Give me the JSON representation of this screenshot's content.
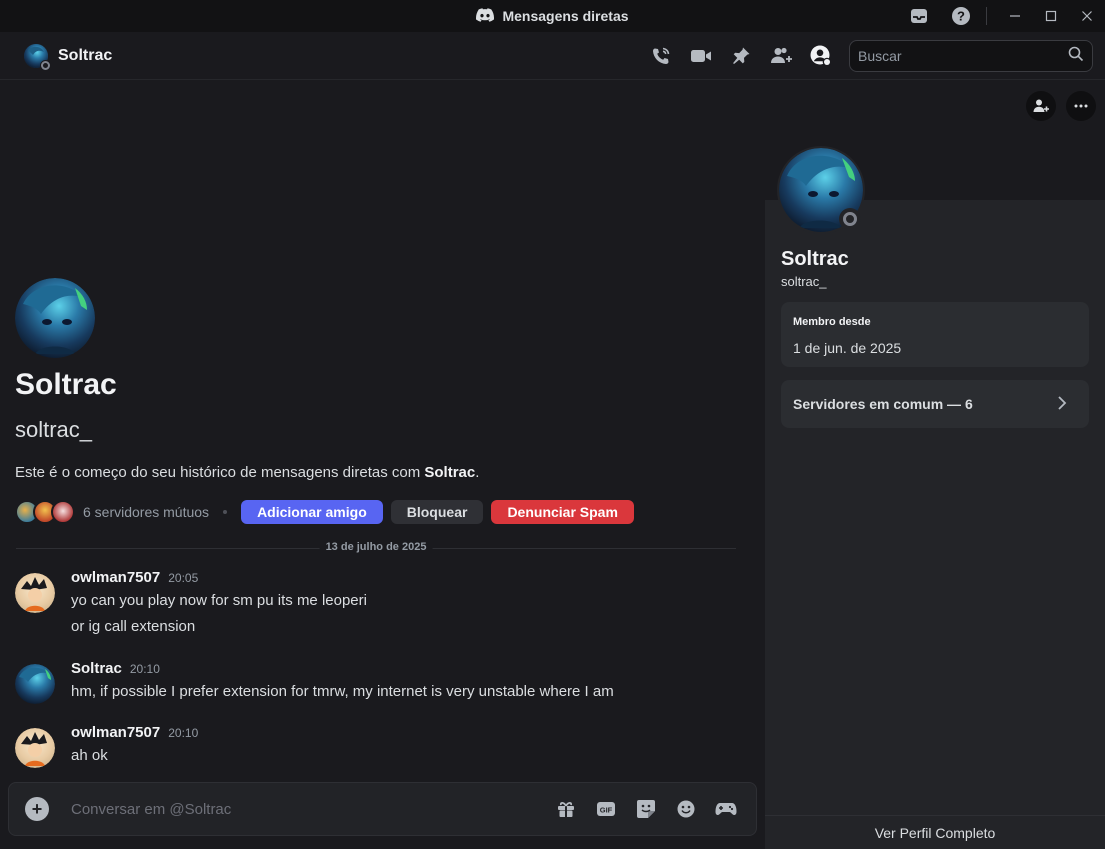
{
  "window": {
    "title": "Mensagens diretas",
    "controls": [
      "inbox-icon",
      "help-icon",
      "minimize-icon",
      "maximize-icon",
      "close-icon"
    ]
  },
  "header": {
    "user_name": "Soltrac",
    "actions": [
      "phone-call-icon",
      "video-call-icon",
      "pin-icon",
      "add-friends-to-dm-icon",
      "user-profile-icon"
    ],
    "search": {
      "placeholder": "Buscar"
    }
  },
  "intro": {
    "name": "Soltrac",
    "handle": "soltrac_",
    "text_prefix": "Este é o começo do seu histórico de mensagens diretas com ",
    "text_bold": "Soltrac",
    "text_suffix": ".",
    "mutual_servers": "6 servidores mútuos",
    "buttons": {
      "add_friend": "Adicionar amigo",
      "block": "Bloquear",
      "report": "Denunciar Spam"
    }
  },
  "date_divider": "13 de julho de 2025",
  "messages": [
    {
      "author": "owlman7507",
      "time": "20:05",
      "lines": [
        "yo can you play now for sm pu its me leoperi",
        "or ig call extension"
      ]
    },
    {
      "author": "Soltrac",
      "time": "20:10",
      "lines": [
        "hm, if possible I prefer extension for tmrw, my internet is very unstable where I am"
      ]
    },
    {
      "author": "owlman7507",
      "time": "20:10",
      "lines": [
        "ah ok"
      ]
    }
  ],
  "composer": {
    "placeholder": "Conversar em @Soltrac",
    "tools": [
      "gift-icon",
      "gif-icon",
      "sticker-icon",
      "emoji-icon",
      "game-controller-icon"
    ]
  },
  "profile_panel": {
    "name": "Soltrac",
    "handle": "soltrac_",
    "member_since_label": "Membro desde",
    "member_since_value": "1 de jun. de 2025",
    "mutual_servers_label": "Servidores em comum — 6",
    "footer": "Ver Perfil Completo"
  },
  "colors": {
    "background": "#1a1a1e",
    "panel": "#232428",
    "primary": "#5865f2",
    "danger": "#da373c",
    "status_offline": "#80848e"
  }
}
